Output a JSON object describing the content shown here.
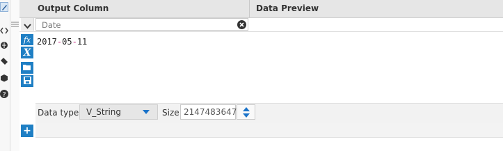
{
  "header": {
    "output_column": "Output Column",
    "data_preview": "Data Preview"
  },
  "row": {
    "name_value": "Date",
    "expression_parts": [
      "2017",
      "-",
      "05",
      "-",
      "11"
    ]
  },
  "side_buttons": {
    "fx": "fx",
    "x": "X"
  },
  "datatype": {
    "label": "Data type:",
    "selected": "V_String"
  },
  "size": {
    "label": "Size:",
    "value": "2147483647"
  },
  "add": {
    "label": "+"
  },
  "colors": {
    "accent": "#1f7fc4",
    "header_bg": "#e6e6e6",
    "punctuation": "#c21c7b"
  },
  "icons": [
    "edit-icon",
    "code-icon",
    "globe-icon",
    "tag-icon",
    "cube-icon",
    "help-icon",
    "grip-icon",
    "chevron-down-icon",
    "clear-icon",
    "folder-icon",
    "save-icon"
  ]
}
